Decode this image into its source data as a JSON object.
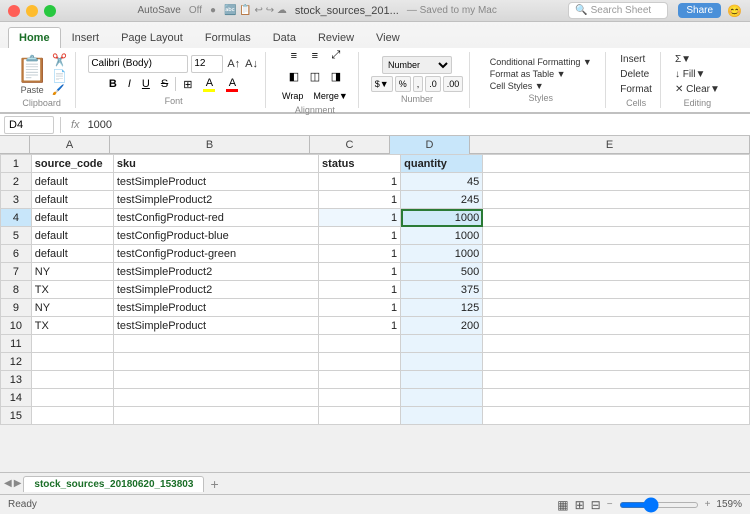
{
  "titleBar": {
    "autosave_label": "AutoSave",
    "autosave_state": "Off",
    "filename": "stock_sources_201...",
    "saved_label": "— Saved to my Mac",
    "search_placeholder": "Search Sheet",
    "share_label": "Share"
  },
  "ribbon": {
    "tabs": [
      "Home",
      "Insert",
      "Page Layout",
      "Formulas",
      "Data",
      "Review",
      "View"
    ],
    "active_tab": "Home"
  },
  "toolbar": {
    "paste_label": "Paste",
    "font_name": "Calibri (Body)",
    "font_size": "12",
    "bold": "B",
    "italic": "I",
    "underline": "U",
    "number_label": "Number",
    "conditional_formatting": "Conditional Formatting ▼",
    "format_as_table": "Format as Table ▼",
    "cell_styles": "Cell Styles ▼",
    "cells_label": "Cells",
    "editing_label": "Editing"
  },
  "formulaBar": {
    "cell_ref": "D4",
    "fx": "fx",
    "formula_value": "1000"
  },
  "columns": {
    "headers": [
      "A",
      "B",
      "C",
      "D",
      "E"
    ],
    "labels": [
      "source_code",
      "sku",
      "status",
      "quantity",
      ""
    ]
  },
  "rows": [
    {
      "num": "1",
      "a": "source_code",
      "b": "sku",
      "c": "status",
      "d": "quantity",
      "e": ""
    },
    {
      "num": "2",
      "a": "default",
      "b": "testSimpleProduct",
      "c": "1",
      "d": "45",
      "e": ""
    },
    {
      "num": "3",
      "a": "default",
      "b": "testSimpleProduct2",
      "c": "1",
      "d": "245",
      "e": ""
    },
    {
      "num": "4",
      "a": "default",
      "b": "testConfigProduct-red",
      "c": "1",
      "d": "1000",
      "e": ""
    },
    {
      "num": "5",
      "a": "default",
      "b": "testConfigProduct-blue",
      "c": "1",
      "d": "1000",
      "e": ""
    },
    {
      "num": "6",
      "a": "default",
      "b": "testConfigProduct-green",
      "c": "1",
      "d": "1000",
      "e": ""
    },
    {
      "num": "7",
      "a": "NY",
      "b": "testSimpleProduct2",
      "c": "1",
      "d": "500",
      "e": ""
    },
    {
      "num": "8",
      "a": "TX",
      "b": "testSimpleProduct2",
      "c": "1",
      "d": "375",
      "e": ""
    },
    {
      "num": "9",
      "a": "NY",
      "b": "testSimpleProduct",
      "c": "1",
      "d": "125",
      "e": ""
    },
    {
      "num": "10",
      "a": "TX",
      "b": "testSimpleProduct",
      "c": "1",
      "d": "200",
      "e": ""
    },
    {
      "num": "11",
      "a": "",
      "b": "",
      "c": "",
      "d": "",
      "e": ""
    },
    {
      "num": "12",
      "a": "",
      "b": "",
      "c": "",
      "d": "",
      "e": ""
    },
    {
      "num": "13",
      "a": "",
      "b": "",
      "c": "",
      "d": "",
      "e": ""
    },
    {
      "num": "14",
      "a": "",
      "b": "",
      "c": "",
      "d": "",
      "e": ""
    },
    {
      "num": "15",
      "a": "",
      "b": "",
      "c": "",
      "d": "",
      "e": ""
    }
  ],
  "sheetTab": {
    "name": "stock_sources_20180620_153803",
    "add_label": "+"
  },
  "statusBar": {
    "ready": "Ready",
    "zoom": "159%"
  }
}
